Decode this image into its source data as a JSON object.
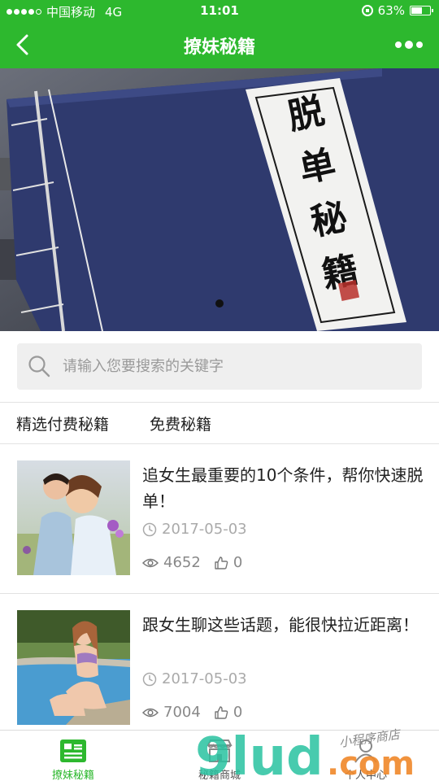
{
  "status_bar": {
    "carrier": "中国移动",
    "network": "4G",
    "time": "11:01",
    "battery": "63%",
    "battery_level": 0.63
  },
  "nav": {
    "title": "撩妹秘籍",
    "back_icon": "chevron-left-icon",
    "more_icon": "more-dots-icon"
  },
  "banner": {
    "book_title": "脱单秘籍",
    "slide_count": 1,
    "active_slide": 1
  },
  "search": {
    "placeholder": "请输入您要搜索的关键字",
    "icon": "search-icon"
  },
  "categories": [
    {
      "label": "精选付费秘籍"
    },
    {
      "label": "免费秘籍"
    }
  ],
  "articles": [
    {
      "title": "追女生最重要的10个条件，帮你快速脱单！",
      "date": "2017-05-03",
      "views": "4652",
      "likes": "0"
    },
    {
      "title": "跟女生聊这些话题，能很快拉近距离！",
      "date": "2017-05-03",
      "views": "7004",
      "likes": "0"
    }
  ],
  "tabbar": {
    "items": [
      {
        "label": "撩妹秘籍",
        "icon": "article-icon",
        "active": true
      },
      {
        "label": "秘籍商城",
        "icon": "shop-icon",
        "active": false
      },
      {
        "label": "个人中心",
        "icon": "person-icon",
        "active": false
      }
    ]
  },
  "watermark": {
    "text": "9lud.com",
    "subtext": "小程序商店"
  },
  "colors": {
    "brand_green": "#2db82e",
    "book_blue": "#2f3a6e"
  }
}
